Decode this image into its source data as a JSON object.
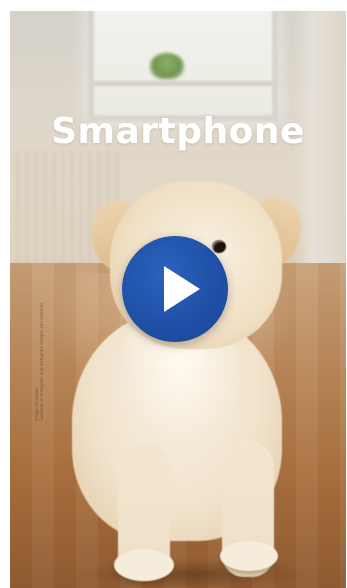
{
  "video": {
    "title": "Smartphone",
    "disclaimer_line1": "Image simulated.",
    "disclaimer_line2": "Contents of Instagram and Instagram images and contents"
  },
  "controls": {
    "play_icon": "play-icon"
  },
  "colors": {
    "play_button": "#1f4fa5",
    "title_text": "#ffffff"
  }
}
